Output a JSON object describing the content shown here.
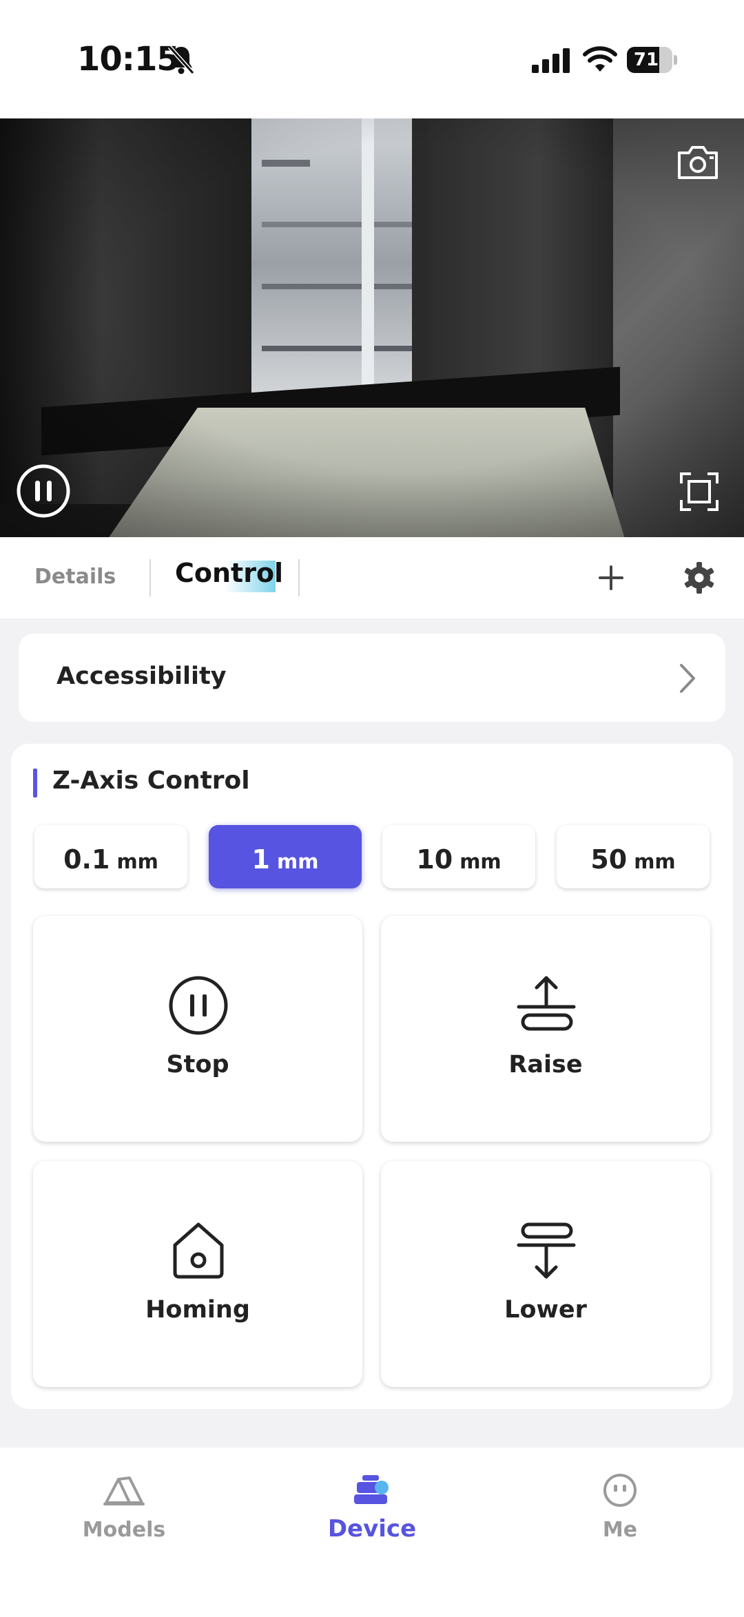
{
  "status_bar": {
    "time": "10:15",
    "battery_percent": "71",
    "battery_level": 0.71,
    "icons": [
      "bell-slash-icon",
      "signal-icon",
      "wifi-icon",
      "battery-icon"
    ]
  },
  "camera": {
    "icons": [
      "camera-snapshot-icon",
      "pause-circle-icon",
      "fullscreen-icon"
    ]
  },
  "tabs": {
    "details_label": "Details",
    "control_label": "Control",
    "active": "Control",
    "icons": [
      "plus-icon",
      "gear-icon"
    ]
  },
  "accessibility": {
    "label": "Accessibility"
  },
  "z_axis": {
    "title": "Z-Axis Control",
    "accent_color": "#5654e0",
    "steps": [
      {
        "value": "0.1",
        "unit": "mm",
        "selected": false
      },
      {
        "value": "1",
        "unit": "mm",
        "selected": true
      },
      {
        "value": "10",
        "unit": "mm",
        "selected": false
      },
      {
        "value": "50",
        "unit": "mm",
        "selected": false
      }
    ],
    "actions": [
      {
        "label": "Stop",
        "icon": "pause-circle-icon"
      },
      {
        "label": "Raise",
        "icon": "raise-icon"
      },
      {
        "label": "Homing",
        "icon": "home-icon"
      },
      {
        "label": "Lower",
        "icon": "lower-icon"
      }
    ]
  },
  "bottom_nav": {
    "items": [
      {
        "label": "Models",
        "icon": "models-icon",
        "active": false
      },
      {
        "label": "Device",
        "icon": "device-icon",
        "active": true
      },
      {
        "label": "Me",
        "icon": "me-icon",
        "active": false
      }
    ]
  }
}
